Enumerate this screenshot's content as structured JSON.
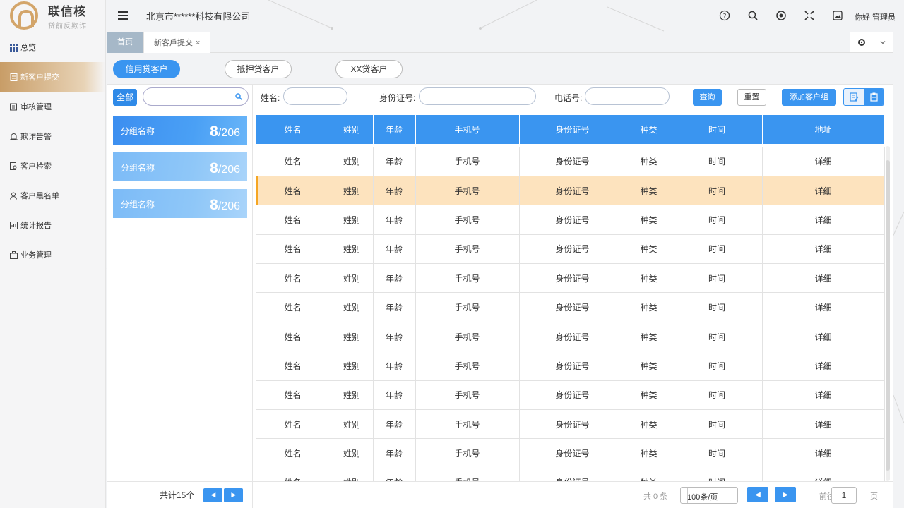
{
  "app": {
    "logo_title": "联信核",
    "logo_subtitle": "贷前反欺诈",
    "company": "北京市******科技有限公司",
    "greeting": "你好 管理员"
  },
  "sidebar": {
    "items": [
      {
        "label": "总览",
        "icon": "grid-icon"
      },
      {
        "label": "新客户提交",
        "icon": "document-icon",
        "active": true
      },
      {
        "label": "审核管理",
        "icon": "edit-icon"
      },
      {
        "label": "欺诈告警",
        "icon": "alarm-icon"
      },
      {
        "label": "客户检索",
        "icon": "search-doc-icon"
      },
      {
        "label": "客户黑名单",
        "icon": "user-icon"
      },
      {
        "label": "统计报告",
        "icon": "chart-icon"
      },
      {
        "label": "业务管理",
        "icon": "briefcase-icon"
      }
    ]
  },
  "tabs": {
    "home": "首页",
    "current": "新客戶提交",
    "close": "×"
  },
  "types": [
    "信用贷客户",
    "抵押贷客户",
    "XX贷客户"
  ],
  "groups": {
    "all_label": "全部",
    "search_placeholder": "",
    "items": [
      {
        "name": "分组名称",
        "count": "8",
        "total": "/206"
      },
      {
        "name": "分组名称",
        "count": "8",
        "total": "/206"
      },
      {
        "name": "分组名称",
        "count": "8",
        "total": "/206"
      }
    ],
    "total_text": "共计15个"
  },
  "search": {
    "name_label": "姓名:",
    "id_label": "身份证号:",
    "phone_label": "电话号:",
    "query_button": "查询",
    "reset_button": "重置",
    "add_group_button": "添加客户组"
  },
  "table": {
    "headers": [
      "姓名",
      "姓别",
      "年龄",
      "手机号",
      "身份证号",
      "种类",
      "时间",
      "地址"
    ],
    "rows": [
      [
        "姓名",
        "姓别",
        "年龄",
        "手机号",
        "身份证号",
        "种类",
        "时间",
        "详细"
      ],
      [
        "姓名",
        "姓别",
        "年龄",
        "手机号",
        "身份证号",
        "种类",
        "时间",
        "详细"
      ],
      [
        "姓名",
        "姓别",
        "年龄",
        "手机号",
        "身份证号",
        "种类",
        "时间",
        "详细"
      ],
      [
        "姓名",
        "姓别",
        "年龄",
        "手机号",
        "身份证号",
        "种类",
        "时间",
        "详细"
      ],
      [
        "姓名",
        "姓别",
        "年龄",
        "手机号",
        "身份证号",
        "种类",
        "时间",
        "详细"
      ],
      [
        "姓名",
        "姓别",
        "年龄",
        "手机号",
        "身份证号",
        "种类",
        "时间",
        "详细"
      ],
      [
        "姓名",
        "姓别",
        "年龄",
        "手机号",
        "身份证号",
        "种类",
        "时间",
        "详细"
      ],
      [
        "姓名",
        "姓别",
        "年龄",
        "手机号",
        "身份证号",
        "种类",
        "时间",
        "详细"
      ],
      [
        "姓名",
        "姓别",
        "年龄",
        "手机号",
        "身份证号",
        "种类",
        "时间",
        "详细"
      ],
      [
        "姓名",
        "姓别",
        "年龄",
        "手机号",
        "身份证号",
        "种类",
        "时间",
        "详细"
      ],
      [
        "姓名",
        "姓别",
        "年龄",
        "手机号",
        "身份证号",
        "种类",
        "时间",
        "详细"
      ],
      [
        "姓名",
        "姓别",
        "年龄",
        "手机号",
        "身份证号",
        "种类",
        "时间",
        "详细"
      ]
    ],
    "highlighted_row": 1
  },
  "pager": {
    "total": "共 0 条",
    "page_size": "100条/页",
    "goto_label": "前往",
    "page_value": "1",
    "page_suffix": "页"
  },
  "colors": {
    "primary": "#3a95f0",
    "accent_gold": "#c89d67",
    "highlight_row": "#fde3be"
  }
}
